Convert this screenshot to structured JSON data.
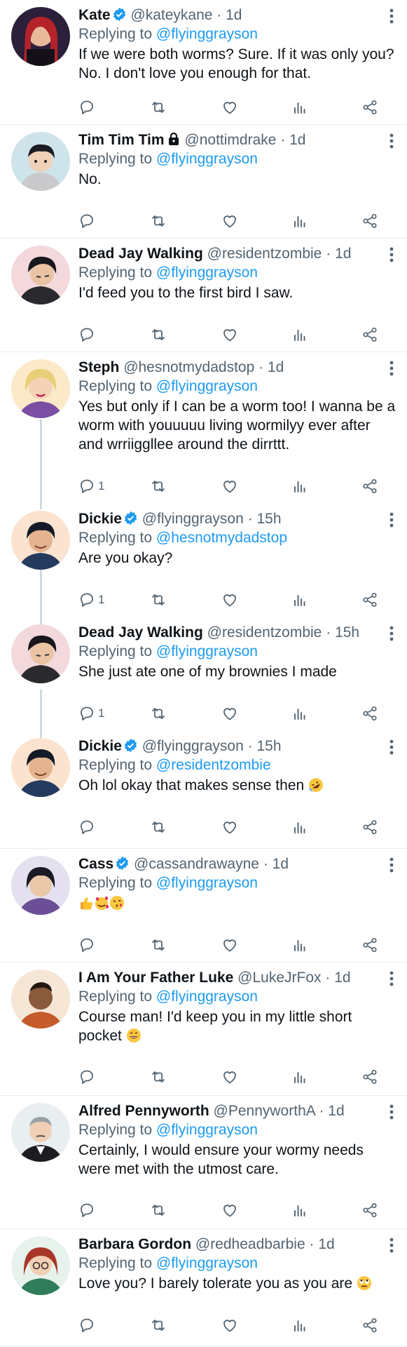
{
  "colors": {
    "accent": "#1d9bf0",
    "secondary": "#536471",
    "text": "#0f1419",
    "divider": "#e6ecf0",
    "thread": "#cfd9de"
  },
  "icons": [
    "more-icon",
    "reply-icon",
    "retweet-icon",
    "like-icon",
    "stats-icon",
    "share-icon",
    "verified-badge-icon",
    "lock-icon"
  ],
  "tweets": [
    {
      "name": "Kate",
      "handle": "@kateykane",
      "dot": "·",
      "time": "1d",
      "reply_prefix": "Replying to",
      "reply_to": "@flyinggrayson",
      "text": "If we were both worms? Sure. If it was only you? No. I don't love you enough for that.",
      "reply_count": ""
    },
    {
      "name": "Tim Tim Tim",
      "handle": "@nottimdrake",
      "dot": "·",
      "time": "1d",
      "reply_prefix": "Replying to",
      "reply_to": "@flyinggrayson",
      "text": "No.",
      "reply_count": ""
    },
    {
      "name": "Dead Jay Walking",
      "handle": "@residentzombie",
      "dot": "·",
      "time": "1d",
      "reply_prefix": "Replying to",
      "reply_to": "@flyinggrayson",
      "text": "I'd feed you to the first bird I saw.",
      "reply_count": ""
    },
    {
      "name": "Steph",
      "handle": "@hesnotmydadstop",
      "dot": "·",
      "time": "1d",
      "reply_prefix": "Replying to",
      "reply_to": "@flyinggrayson",
      "text": "Yes but only if I can be a worm too! I wanna be a worm with youuuuu living wormilyy ever after and wrriiggllee around the dirrttt.",
      "reply_count": "1"
    },
    {
      "name": "Dickie",
      "handle": "@flyinggrayson",
      "dot": "·",
      "time": "15h",
      "reply_prefix": "Replying to",
      "reply_to": "@hesnotmydadstop",
      "text": "Are you okay?",
      "reply_count": "1"
    },
    {
      "name": "Dead Jay Walking",
      "handle": "@residentzombie",
      "dot": "·",
      "time": "15h",
      "reply_prefix": "Replying to",
      "reply_to": "@flyinggrayson",
      "text": "She just ate one of my brownies I made",
      "reply_count": "1"
    },
    {
      "name": "Dickie",
      "handle": "@flyinggrayson",
      "dot": "·",
      "time": "15h",
      "reply_prefix": "Replying to",
      "reply_to": "@residentzombie",
      "text": "Oh lol okay that makes sense then",
      "reply_count": ""
    },
    {
      "name": "Cass",
      "handle": "@cassandrawayne",
      "dot": "·",
      "time": "1d",
      "reply_prefix": "Replying to",
      "reply_to": "@flyinggrayson",
      "text": "",
      "reply_count": ""
    },
    {
      "name": "I Am Your Father Luke",
      "handle": "@LukeJrFox",
      "dot": "·",
      "time": "1d",
      "reply_prefix": "Replying to",
      "reply_to": "@flyinggrayson",
      "text": "Course man! I'd keep you in my little short pocket",
      "reply_count": ""
    },
    {
      "name": "Alfred Pennyworth",
      "handle": "@PennyworthA",
      "dot": "·",
      "time": "1d",
      "reply_prefix": "Replying to",
      "reply_to": "@flyinggrayson",
      "text": "Certainly, I would ensure your wormy needs were met with the utmost care.",
      "reply_count": ""
    },
    {
      "name": "Barbara Gordon",
      "handle": "@redheadbarbie",
      "dot": "·",
      "time": "1d",
      "reply_prefix": "Replying to",
      "reply_to": "@flyinggrayson",
      "text": "Love you? I barely tolerate you as you are",
      "reply_count": ""
    }
  ]
}
